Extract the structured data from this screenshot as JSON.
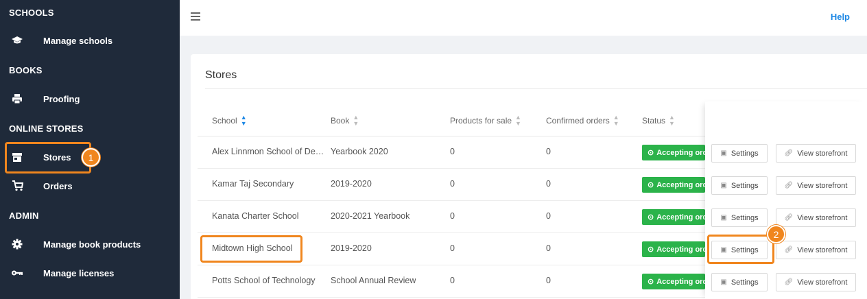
{
  "sidebar": {
    "sections": [
      {
        "title": "SCHOOLS",
        "items": [
          {
            "label": "Manage schools",
            "icon": "graduation-cap-icon"
          }
        ]
      },
      {
        "title": "BOOKS",
        "items": [
          {
            "label": "Proofing",
            "icon": "printer-icon"
          }
        ]
      },
      {
        "title": "ONLINE STORES",
        "items": [
          {
            "label": "Stores",
            "icon": "store-icon"
          },
          {
            "label": "Orders",
            "icon": "cart-icon"
          }
        ]
      },
      {
        "title": "ADMIN",
        "items": [
          {
            "label": "Manage book products",
            "icon": "gear-icon"
          },
          {
            "label": "Manage licenses",
            "icon": "key-icon"
          }
        ]
      }
    ],
    "active_item": "Stores"
  },
  "topbar": {
    "help_label": "Help"
  },
  "main": {
    "title": "Stores",
    "columns": [
      "School",
      "Book",
      "Products for sale",
      "Confirmed orders",
      "Status"
    ],
    "rows": [
      {
        "school": "Alex Linnmon School of De…",
        "book": "Yearbook 2020",
        "products": "0",
        "orders": "0",
        "status": "Accepting orders"
      },
      {
        "school": "Kamar Taj Secondary",
        "book": "2019-2020",
        "products": "0",
        "orders": "0",
        "status": "Accepting orders"
      },
      {
        "school": "Kanata Charter School",
        "book": "2020-2021 Yearbook",
        "products": "0",
        "orders": "0",
        "status": "Accepting orders"
      },
      {
        "school": "Midtown High School",
        "book": "2019-2020",
        "products": "0",
        "orders": "0",
        "status": "Accepting orders"
      },
      {
        "school": "Potts School of Technology",
        "book": "School Annual Review",
        "products": "0",
        "orders": "0",
        "status": "Accepting orders"
      }
    ],
    "actions": {
      "settings_label": "Settings",
      "storefront_label": "View storefront"
    }
  },
  "annotations": {
    "step1": "1",
    "step2": "2"
  },
  "colors": {
    "sidebar_bg": "#1f2a3a",
    "accent": "#1e88e5",
    "status_green": "#2bb34a",
    "highlight": "#f0861e"
  }
}
